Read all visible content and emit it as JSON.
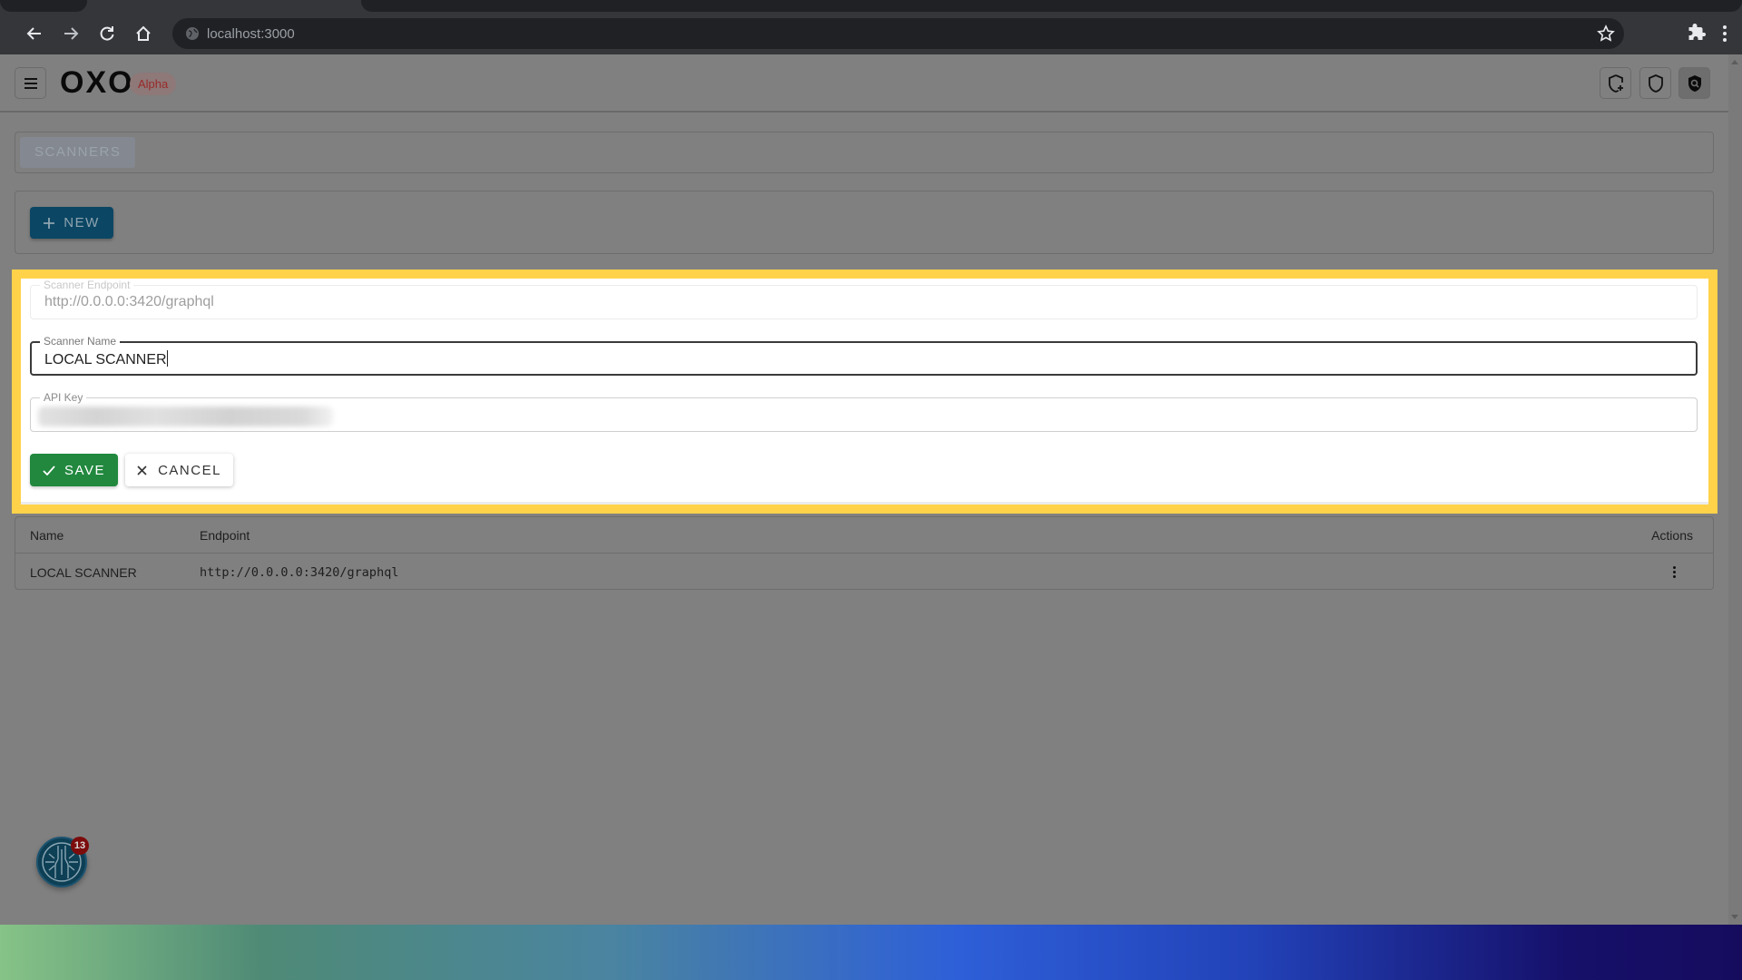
{
  "browser": {
    "url": "localhost:3000",
    "icons": [
      "back-icon",
      "forward-icon",
      "reload-icon",
      "home-icon",
      "site-info-icon",
      "bookmark-star-icon",
      "extensions-icon",
      "browser-menu-icon"
    ]
  },
  "header": {
    "logo": "OXO",
    "badge": "Alpha",
    "actions": [
      {
        "name": "add-scanner-shield-icon"
      },
      {
        "name": "shield-icon"
      },
      {
        "name": "shield-search-icon",
        "active": true
      }
    ]
  },
  "tabs": [
    {
      "label": "SCANNERS",
      "active": true
    }
  ],
  "toolbar": {
    "new_label": "NEW"
  },
  "form": {
    "endpoint": {
      "label": "Scanner Endpoint",
      "value": "http://0.0.0.0:3420/graphql",
      "disabled": true
    },
    "name": {
      "label": "Scanner Name",
      "value": "LOCAL SCANNER",
      "focused": true
    },
    "api_key": {
      "label": "API Key",
      "value": "(blurred)"
    },
    "save_label": "SAVE",
    "cancel_label": "CANCEL"
  },
  "table": {
    "columns": [
      "Name",
      "Endpoint",
      "Actions"
    ],
    "rows": [
      {
        "name": "LOCAL SCANNER",
        "endpoint": "http://0.0.0.0:3420/graphql"
      }
    ]
  },
  "notifications": {
    "count": "13"
  },
  "colors": {
    "highlight": "#ffd24a",
    "save": "#21883e",
    "primary": "#0b4664",
    "alpha_badge": "#9a2a2a"
  }
}
